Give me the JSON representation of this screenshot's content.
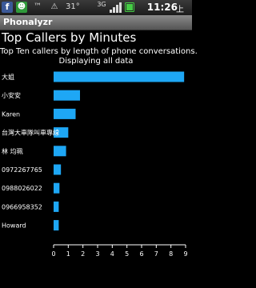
{
  "status_bar": {
    "icons": [
      "facebook-icon",
      "contacts-icon",
      "usb-icon",
      "debug-icon"
    ],
    "temperature": "31°",
    "network": "3G",
    "time": "11:26",
    "ampm": "上午",
    "battery_icon": "battery-icon"
  },
  "app": {
    "title": "Phonalyzr"
  },
  "page": {
    "title": "Top Callers by Minutes",
    "subtitle": "Top Ten callers by length of phone conversations.",
    "subtitle2": "Displaying all data"
  },
  "colors": {
    "bar": "#1ea7f5",
    "background": "#000000",
    "axis": "#ffffff"
  },
  "chart_data": {
    "type": "bar",
    "orientation": "horizontal",
    "title": "Top Callers by Minutes",
    "categories": [
      "大姐",
      "小安安",
      "Karen",
      "台灣大車隊叫車專線",
      "林 均珮",
      "0972267765",
      "0988026022",
      "0966958352",
      "Howard"
    ],
    "values": [
      8.9,
      1.8,
      1.5,
      1.0,
      0.85,
      0.5,
      0.4,
      0.35,
      0.35
    ],
    "xlim": [
      0,
      9
    ],
    "xticks": [
      "0",
      "1",
      "2",
      "3",
      "4",
      "5",
      "6",
      "7",
      "8",
      "9"
    ],
    "grid": false
  }
}
